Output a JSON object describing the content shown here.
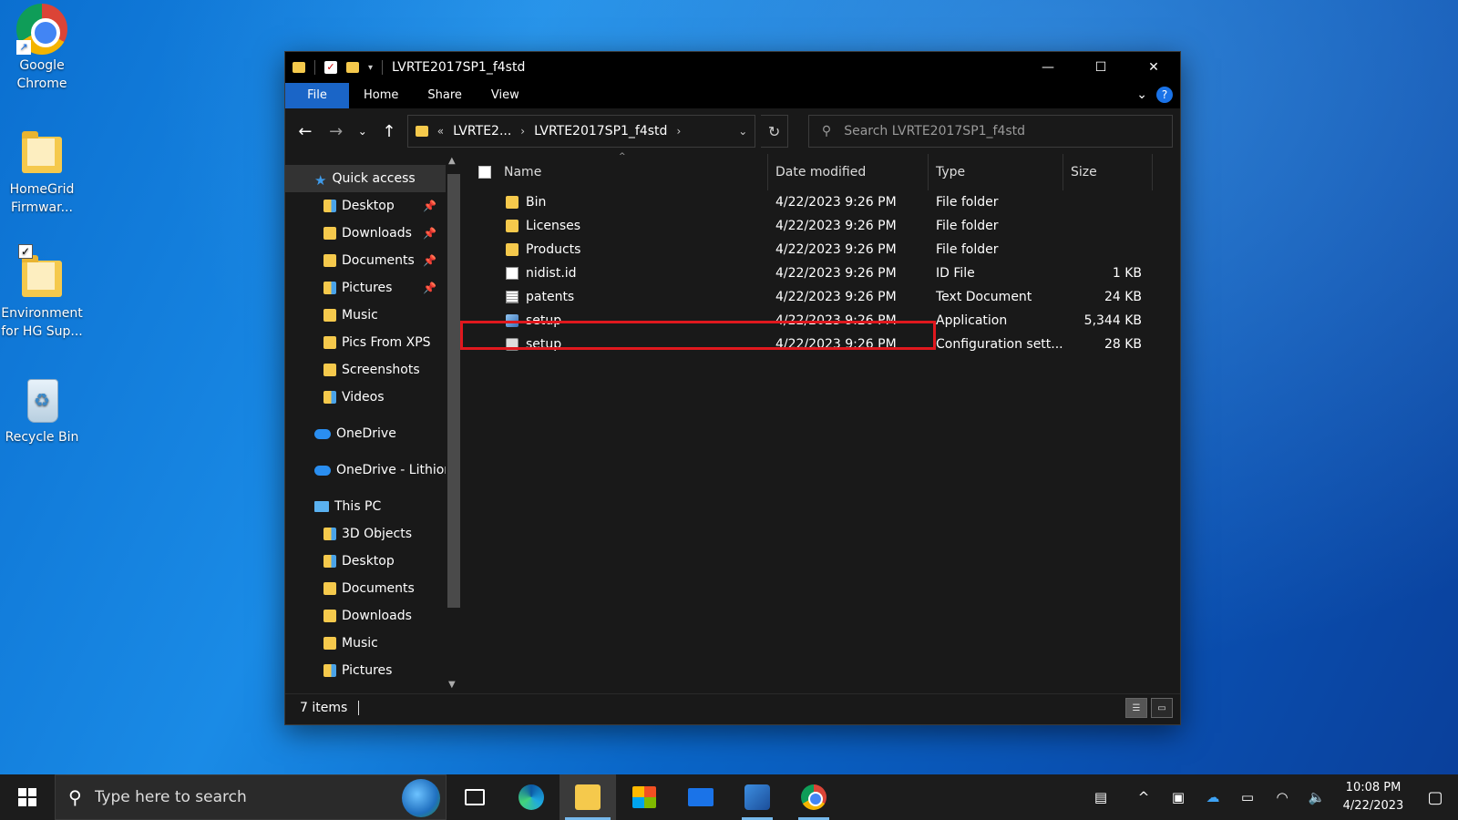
{
  "desktop": {
    "icons": [
      {
        "label_line1": "Google",
        "label_line2": "Chrome"
      },
      {
        "label_line1": "HomeGrid",
        "label_line2": "Firmwar..."
      },
      {
        "label_line1": "Environment",
        "label_line2": "for HG Sup..."
      },
      {
        "label_line1": "Recycle Bin",
        "label_line2": ""
      }
    ]
  },
  "window": {
    "title": "LVRTE2017SP1_f4std",
    "controls": {
      "minimize": "—",
      "maximize": "☐",
      "close": "✕"
    },
    "ribbon_tabs": [
      "File",
      "Home",
      "Share",
      "View"
    ],
    "help_label": "?",
    "address": {
      "crumbs": [
        "LVRTE2...",
        "LVRTE2017SP1_f4std"
      ]
    },
    "search": {
      "placeholder": "Search LVRTE2017SP1_f4std"
    },
    "nav_pane": {
      "items": [
        {
          "label": "Quick access"
        },
        {
          "label": "Desktop",
          "pinned": true
        },
        {
          "label": "Downloads",
          "pinned": true
        },
        {
          "label": "Documents",
          "pinned": true
        },
        {
          "label": "Pictures",
          "pinned": true
        },
        {
          "label": "Music"
        },
        {
          "label": "Pics From XPS"
        },
        {
          "label": "Screenshots"
        },
        {
          "label": "Videos"
        },
        {
          "label": "OneDrive"
        },
        {
          "label": "OneDrive - Lithion"
        },
        {
          "label": "This PC"
        },
        {
          "label": "3D Objects"
        },
        {
          "label": "Desktop"
        },
        {
          "label": "Documents"
        },
        {
          "label": "Downloads"
        },
        {
          "label": "Music"
        },
        {
          "label": "Pictures"
        }
      ]
    },
    "columns": {
      "name": "Name",
      "date": "Date modified",
      "type": "Type",
      "size": "Size"
    },
    "files": [
      {
        "name": "Bin",
        "date": "4/22/2023 9:26 PM",
        "type": "File folder",
        "size": "",
        "icon": "folder-icon"
      },
      {
        "name": "Licenses",
        "date": "4/22/2023 9:26 PM",
        "type": "File folder",
        "size": "",
        "icon": "folder-icon"
      },
      {
        "name": "Products",
        "date": "4/22/2023 9:26 PM",
        "type": "File folder",
        "size": "",
        "icon": "folder-icon"
      },
      {
        "name": "nidist.id",
        "date": "4/22/2023 9:26 PM",
        "type": "ID File",
        "size": "1 KB",
        "icon": "file-icon"
      },
      {
        "name": "patents",
        "date": "4/22/2023 9:26 PM",
        "type": "Text Document",
        "size": "24 KB",
        "icon": "text-file-icon"
      },
      {
        "name": "setup",
        "date": "4/22/2023 9:26 PM",
        "type": "Application",
        "size": "5,344 KB",
        "icon": "application-icon"
      },
      {
        "name": "setup",
        "date": "4/22/2023 9:26 PM",
        "type": "Configuration sett...",
        "size": "28 KB",
        "icon": "config-file-icon"
      }
    ],
    "status": {
      "item_count": "7 items"
    }
  },
  "taskbar": {
    "search_placeholder": "Type here to search",
    "clock_time": "10:08 PM",
    "clock_date": "4/22/2023"
  },
  "colors": {
    "accent": "#1a65c7",
    "highlight_border": "#e0181e",
    "window_bg": "#191919"
  }
}
